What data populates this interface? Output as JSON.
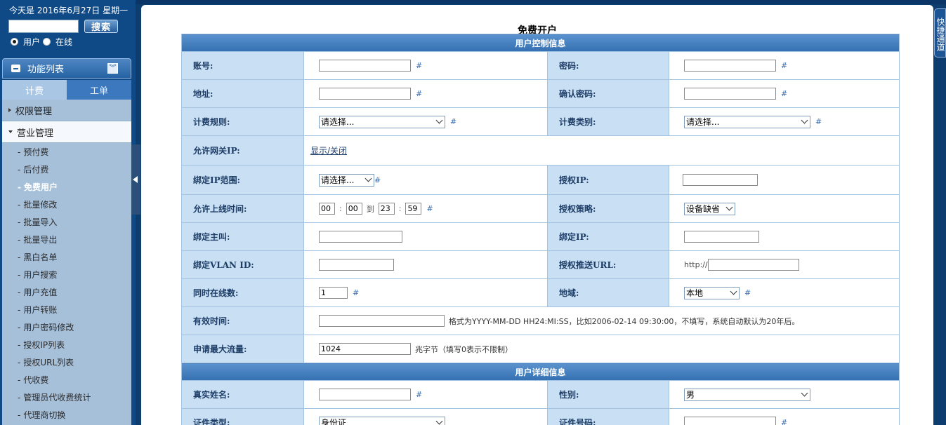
{
  "sidebar": {
    "date_prefix": "今天是",
    "date": "2016年6月27日",
    "weekday": "星期一",
    "search_button": "搜索",
    "search_value": "",
    "radio_user": "用户",
    "radio_online": "在线",
    "menu_title": "功能列表",
    "tabs": [
      "计费",
      "工单"
    ],
    "groups": [
      "权限管理",
      "营业管理"
    ],
    "items": [
      "预付费",
      "后付费",
      "免费用户",
      "批量修改",
      "批量导入",
      "批量导出",
      "黑白名单",
      "用户搜索",
      "用户充值",
      "用户转账",
      "用户密码修改",
      "授权IP列表",
      "授权URL列表",
      "代收费",
      "管理员代收费统计",
      "代理商切换"
    ]
  },
  "quick_tab": "快捷通道",
  "page": {
    "title": "免费开户",
    "section1": "用户控制信息",
    "section2": "用户详细信息",
    "hash": "#",
    "labels": {
      "account": "账号:",
      "password": "密码:",
      "address": "地址:",
      "confirm_password": "确认密码:",
      "billing_rule": "计费规则:",
      "billing_type": "计费类别:",
      "allow_gateway_ip": "允许网关IP:",
      "bind_ip_range": "绑定IP范围:",
      "auth_ip": "授权IP:",
      "allow_online_time": "允许上线时间:",
      "auth_policy": "授权策略:",
      "bind_caller": "绑定主叫:",
      "bind_ip": "绑定IP:",
      "bind_vlan": "绑定VLAN ID:",
      "auth_push_url": "授权推送URL:",
      "max_concurrent": "同时在线数:",
      "region": "地域:",
      "valid_time": "有效时间:",
      "max_traffic": "申请最大流量:",
      "real_name": "真实姓名:",
      "gender": "性别:",
      "id_type": "证件类型:",
      "id_number": "证件号码:"
    },
    "values": {
      "select_placeholder": "请选择...",
      "show_hide": "显示/关闭",
      "time_start_h": "00",
      "time_start_m": "00",
      "time_to": "到",
      "time_end_h": "23",
      "time_end_m": "59",
      "colon": ":",
      "auth_policy": "设备缺省",
      "url_prefix": "http://",
      "max_concurrent": "1",
      "region": "本地",
      "valid_time_note": "格式为YYYY-MM-DD HH24:MI:SS，比如2006-02-14 09:30:00，不填写，系统自动默认为20年后。",
      "max_traffic": "1024",
      "max_traffic_note": "兆字节（填写0表示不限制）",
      "gender": "男",
      "id_type": "身份证"
    }
  }
}
